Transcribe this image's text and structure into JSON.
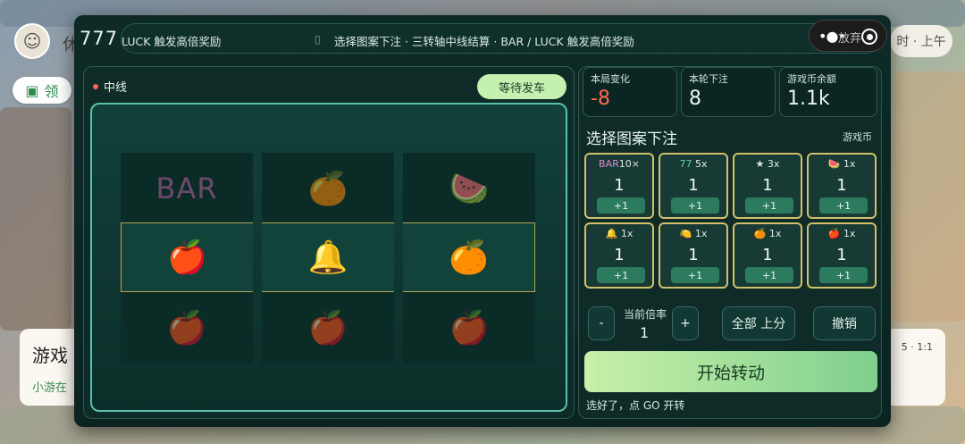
{
  "background": {
    "pill_label": "领",
    "card_title": "游戏",
    "card_sub": "小游在",
    "time_label": "时 · 上午",
    "right_card_text": "5 · 1:1",
    "brand_small": "休"
  },
  "header": {
    "title": "777",
    "ticker_a": "LUCK 触发高倍奖励",
    "ticker_sep": "▯",
    "ticker_b": "选择图案下注 · 三转轴中线结算 · BAR / LUCK 触发高倍奖励",
    "capsule_label": "放弃"
  },
  "left": {
    "line_label": "中线",
    "wait_button": "等待发车",
    "reels": [
      [
        "BAR",
        "🍎",
        "🍎"
      ],
      [
        "🍊",
        "🔔",
        "🍎"
      ],
      [
        "🍉",
        "🍊",
        "🍎"
      ]
    ],
    "bar_text": "BAR"
  },
  "stats": {
    "round_change_label": "本局变化",
    "round_change_value": "-8",
    "bet_label": "本轮下注",
    "bet_value": "8",
    "balance_label": "游戏币余额",
    "balance_value": "1.1k"
  },
  "bet_panel": {
    "title": "选择图案下注",
    "unit": "游戏币",
    "items": [
      {
        "symbol": "BAR",
        "mult": "10×",
        "count": "1",
        "plus": "+1"
      },
      {
        "symbol": "77",
        "mult": "5x",
        "count": "1",
        "plus": "+1"
      },
      {
        "symbol": "★",
        "mult": "3x",
        "count": "1",
        "plus": "+1"
      },
      {
        "symbol": "🍉",
        "mult": "1x",
        "count": "1",
        "plus": "+1"
      },
      {
        "symbol": "🔔",
        "mult": "1x",
        "count": "1",
        "plus": "+1"
      },
      {
        "symbol": "🍋",
        "mult": "1x",
        "count": "1",
        "plus": "+1"
      },
      {
        "symbol": "🍊",
        "mult": "1x",
        "count": "1",
        "plus": "+1"
      },
      {
        "symbol": "🍎",
        "mult": "1x",
        "count": "1",
        "plus": "+1"
      }
    ]
  },
  "controls": {
    "minus": "-",
    "plus": "+",
    "multiplier_label": "当前倍率",
    "multiplier_value": "1",
    "all_up": "全部 上分",
    "undo": "撤销",
    "spin": "开始转动",
    "hint": "选好了，点 GO 开转"
  },
  "colors": {
    "accent_green": "#c4f0b0",
    "negative": "#ff6a50",
    "frame": "#58c0a6",
    "bet_border": "#d2c06a"
  }
}
